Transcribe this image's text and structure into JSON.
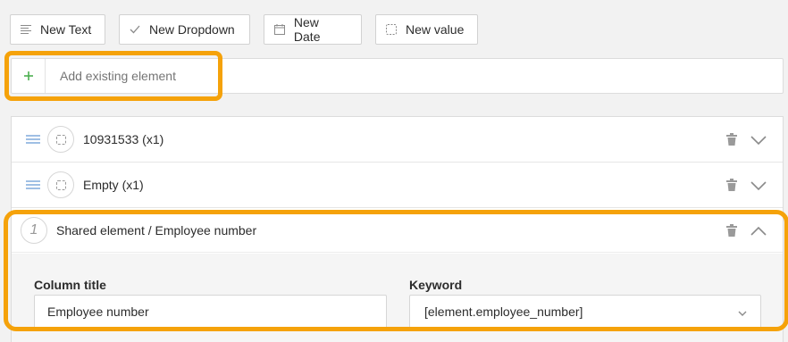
{
  "toolbar": {
    "new_text": "New Text",
    "new_dropdown": "New Dropdown",
    "new_date": "New Date",
    "new_value": "New value"
  },
  "add_existing": {
    "icon": "plus-icon",
    "placeholder": "Add existing element"
  },
  "elements": [
    {
      "label": "10931533 (x1)",
      "icon": "dashed-square-icon"
    },
    {
      "label": "Empty (x1)",
      "icon": "dashed-square-icon"
    }
  ],
  "shared_element": {
    "number": "1",
    "label": "Shared element / Employee number",
    "column_title_label": "Column title",
    "column_title_value": "Employee number",
    "keyword_label": "Keyword",
    "keyword_value": "[element.employee_number]"
  },
  "colors": {
    "highlight": "#f5a20a",
    "plus": "#4caf50",
    "drag_handle": "#9fbfe4"
  }
}
